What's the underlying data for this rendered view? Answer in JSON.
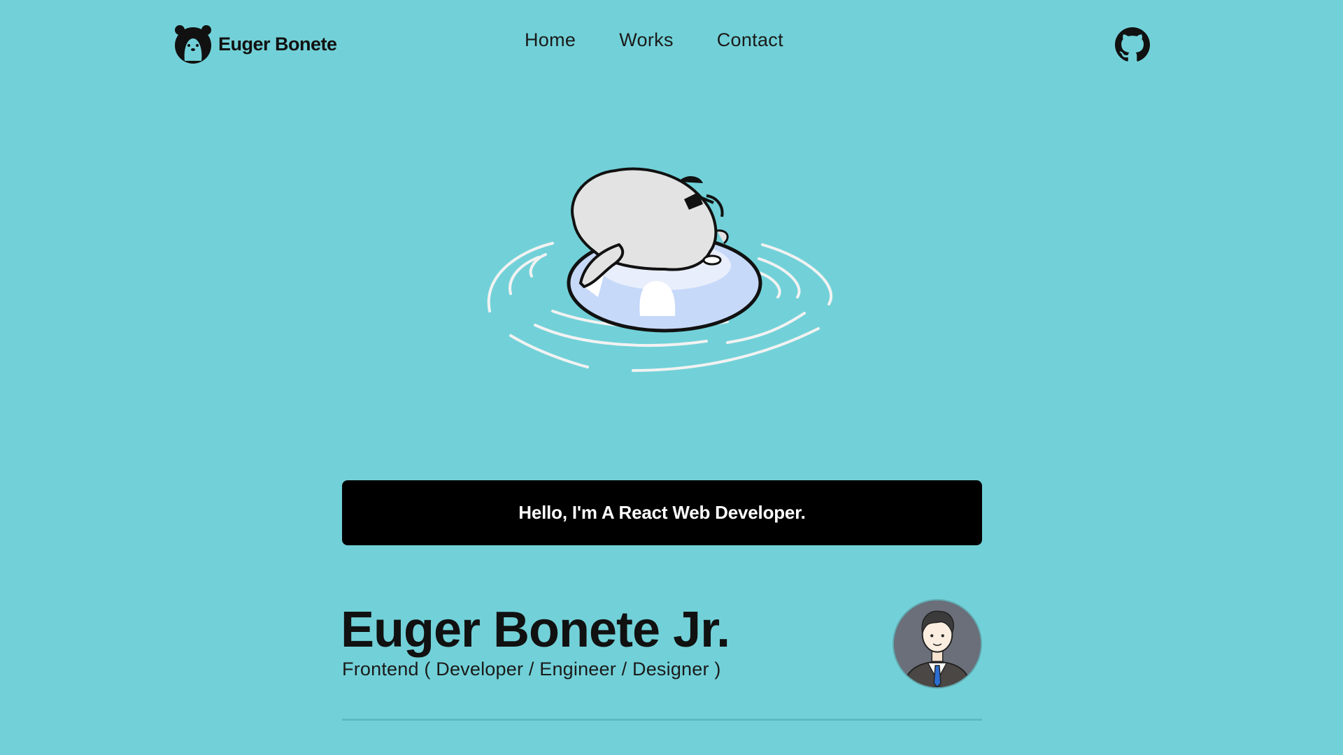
{
  "header": {
    "brand_name": "Euger Bonete",
    "nav": [
      {
        "label": "Home"
      },
      {
        "label": "Works"
      },
      {
        "label": "Contact"
      }
    ],
    "github_icon": "github-icon"
  },
  "hero": {
    "illustration": "polar-bear-floating-on-inner-tube"
  },
  "banner": {
    "text": "Hello, I'm A React Web Developer."
  },
  "profile": {
    "name": "Euger Bonete Jr.",
    "role": "Frontend ( Developer / Engineer / Designer )",
    "avatar": "businessman-avatar"
  },
  "colors": {
    "background": "#72d1d8",
    "banner_bg": "#000000",
    "banner_text": "#ffffff",
    "text": "#111111"
  }
}
